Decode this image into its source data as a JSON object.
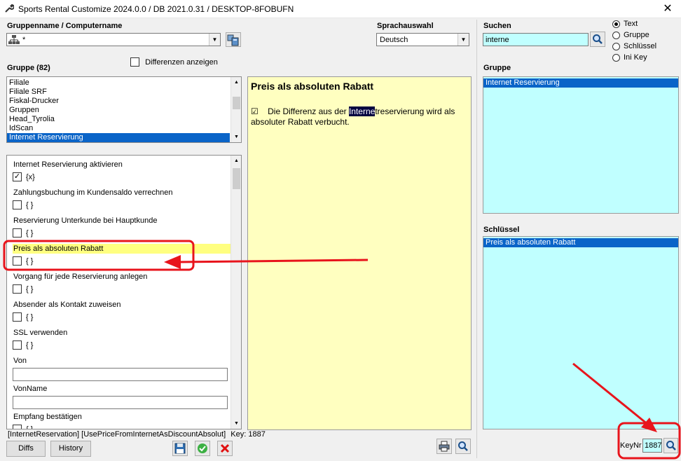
{
  "window": {
    "title": "Sports Rental Customize 2024.0.0 / DB 2021.0.31 /  DESKTOP-8FOBUFN",
    "close_glyph": "✕"
  },
  "group_name": {
    "label": "Gruppenname / Computername",
    "value": "*"
  },
  "language": {
    "label": "Sprachauswahl",
    "value": "Deutsch"
  },
  "show_diffs": {
    "label": "Differenzen anzeigen",
    "checked": false
  },
  "groups": {
    "label": "Gruppe (82)",
    "items": [
      "Filiale",
      "Filiale SRF",
      "Fiskal-Drucker",
      "Gruppen",
      "Head_Tyrolia",
      "IdScan",
      "Internet Reservierung"
    ],
    "selected_index": 6
  },
  "settings": {
    "items": [
      {
        "name": "Internet Reservierung aktivieren",
        "checked": true,
        "value": "{x}"
      },
      {
        "name": "Zahlungsbuchung im Kundensaldo verrechnen",
        "checked": false,
        "value": "{ }"
      },
      {
        "name": "Reservierung Unterkunde bei Hauptkunde",
        "checked": false,
        "value": "{ }"
      },
      {
        "name": "Preis als absoluten Rabatt",
        "checked": false,
        "value": "{ }",
        "highlighted": true
      },
      {
        "name": "Vorgang für jede Reservierung anlegen",
        "checked": false,
        "value": "{ }"
      },
      {
        "name": "Absender als Kontakt zuweisen",
        "checked": false,
        "value": "{ }"
      },
      {
        "name": "SSL verwenden",
        "checked": false,
        "value": "{ }"
      }
    ],
    "text_fields": [
      {
        "name": "Von",
        "value": ""
      },
      {
        "name": "VonName",
        "value": ""
      }
    ],
    "last": {
      "name": "Empfang bestätigen",
      "value": "{ }"
    }
  },
  "status": {
    "key_path": "[InternetReservation] [UsePriceFromInternetAsDiscountAbsolut]",
    "key_label": "Key:",
    "key_value": "1887"
  },
  "description": {
    "title": "Preis als absoluten Rabatt",
    "check_glyph": "☑",
    "text_before": "Die Differenz aus der ",
    "text_highlight": "Interne",
    "text_after": "treservierung wird als absoluter Rabatt verbucht."
  },
  "search": {
    "label": "Suchen",
    "value": "interne",
    "modes": [
      {
        "label": "Text",
        "selected": true
      },
      {
        "label": "Gruppe",
        "selected": false
      },
      {
        "label": "Schlüssel",
        "selected": false
      },
      {
        "label": "Ini Key",
        "selected": false
      }
    ]
  },
  "result_group": {
    "label": "Gruppe",
    "items": [
      "Internet Reservierung"
    ]
  },
  "result_key": {
    "label": "Schlüssel",
    "items": [
      "Preis als absoluten Rabatt"
    ]
  },
  "keynr": {
    "label": "KeyNr",
    "value": "1887"
  },
  "buttons": {
    "diffs": "Diffs",
    "history": "History"
  },
  "icons": {
    "app": "wrench-icon",
    "network": "network-tree-icon",
    "pc": "computer-icon",
    "search": "magnifier-icon",
    "printer": "printer-icon",
    "save": "floppy-disk-icon",
    "ok": "green-check-icon",
    "cancel": "red-x-icon"
  },
  "colors": {
    "selection": "#0a64c8",
    "description_bg": "#ffffc0",
    "results_bg": "#c0ffff",
    "highlight_row": "#ffff80",
    "annotation": "#e8141c"
  }
}
